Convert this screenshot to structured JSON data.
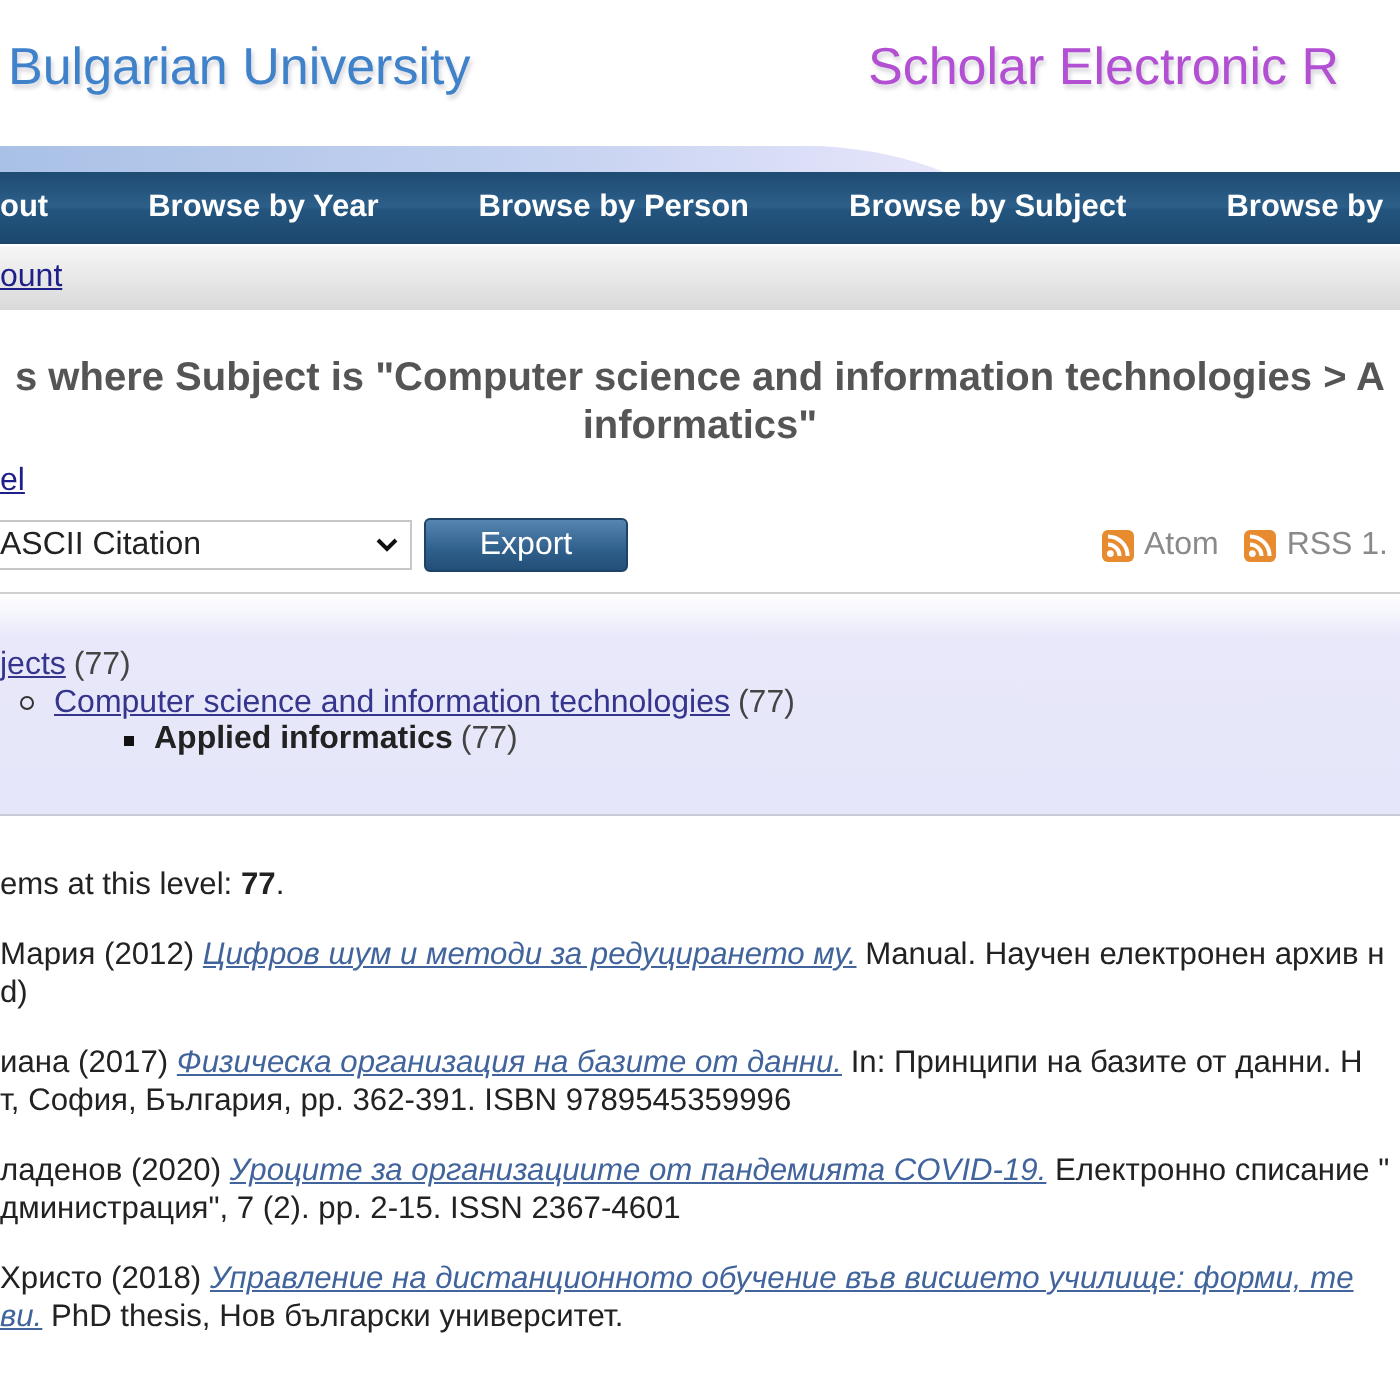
{
  "header": {
    "left_title": "Bulgarian University",
    "right_title": "Scholar Electronic R"
  },
  "nav": [
    "out",
    "Browse by Year",
    "Browse by Person",
    "Browse by Subject",
    "Browse by"
  ],
  "account_bar": {
    "link": "ount"
  },
  "page_title": [
    "s where Subject is \"Computer science and information technologies > A",
    "informatics\""
  ],
  "up_link": "el",
  "export": {
    "format": "ASCII Citation",
    "button": "Export"
  },
  "feeds": [
    {
      "label": "Atom"
    },
    {
      "label": "RSS 1."
    }
  ],
  "subject_tree": {
    "label": "jects",
    "count": "(77)",
    "selected": false,
    "children": [
      {
        "label": "Computer science and information technologies",
        "count": "(77)",
        "selected": false,
        "children": [
          {
            "label": "Applied informatics",
            "count": "(77)",
            "selected": true
          }
        ]
      }
    ]
  },
  "item_count": "ems at this level: **77**.",
  "citations": [
    {
      "lines": [
        [
          {
            "kind": "text",
            "text": "Мария (2012)"
          },
          {
            "kind": "link",
            "text": "Цифров шум и методи за редуцирането му."
          },
          {
            "kind": "text",
            "text": "Manual. Научен електронен архив н"
          }
        ],
        [
          {
            "kind": "text",
            "text": "d)"
          }
        ]
      ]
    },
    {
      "lines": [
        [
          {
            "kind": "text",
            "text": "иана (2017)"
          },
          {
            "kind": "link",
            "text": "Физическа организация на базите от данни."
          },
          {
            "kind": "text",
            "text": "In: Принципи на базите от данни. Н"
          }
        ],
        [
          {
            "kind": "text",
            "text": "т, София, България, pp. 362-391. ISBN 9789545359996"
          }
        ]
      ]
    },
    {
      "lines": [
        [
          {
            "kind": "text",
            "text": "ладенов (2020)"
          },
          {
            "kind": "link",
            "text": "Уроците за организациите от пандемията COVID-19."
          },
          {
            "kind": "text",
            "text": "Електронно списание \""
          }
        ],
        [
          {
            "kind": "text",
            "text": "дминистрация\", 7 (2). pp. 2-15. ISSN 2367-4601"
          }
        ]
      ]
    },
    {
      "lines": [
        [
          {
            "kind": "text",
            "text": "Христо (2018)"
          },
          {
            "kind": "link",
            "text": "Управление на дистанционното обучение във висшето училище: форми, те"
          }
        ],
        [
          {
            "kind": "link",
            "text": "ви."
          },
          {
            "kind": "text",
            "text": "PhD thesis, Нов български университет."
          }
        ]
      ]
    }
  ]
}
